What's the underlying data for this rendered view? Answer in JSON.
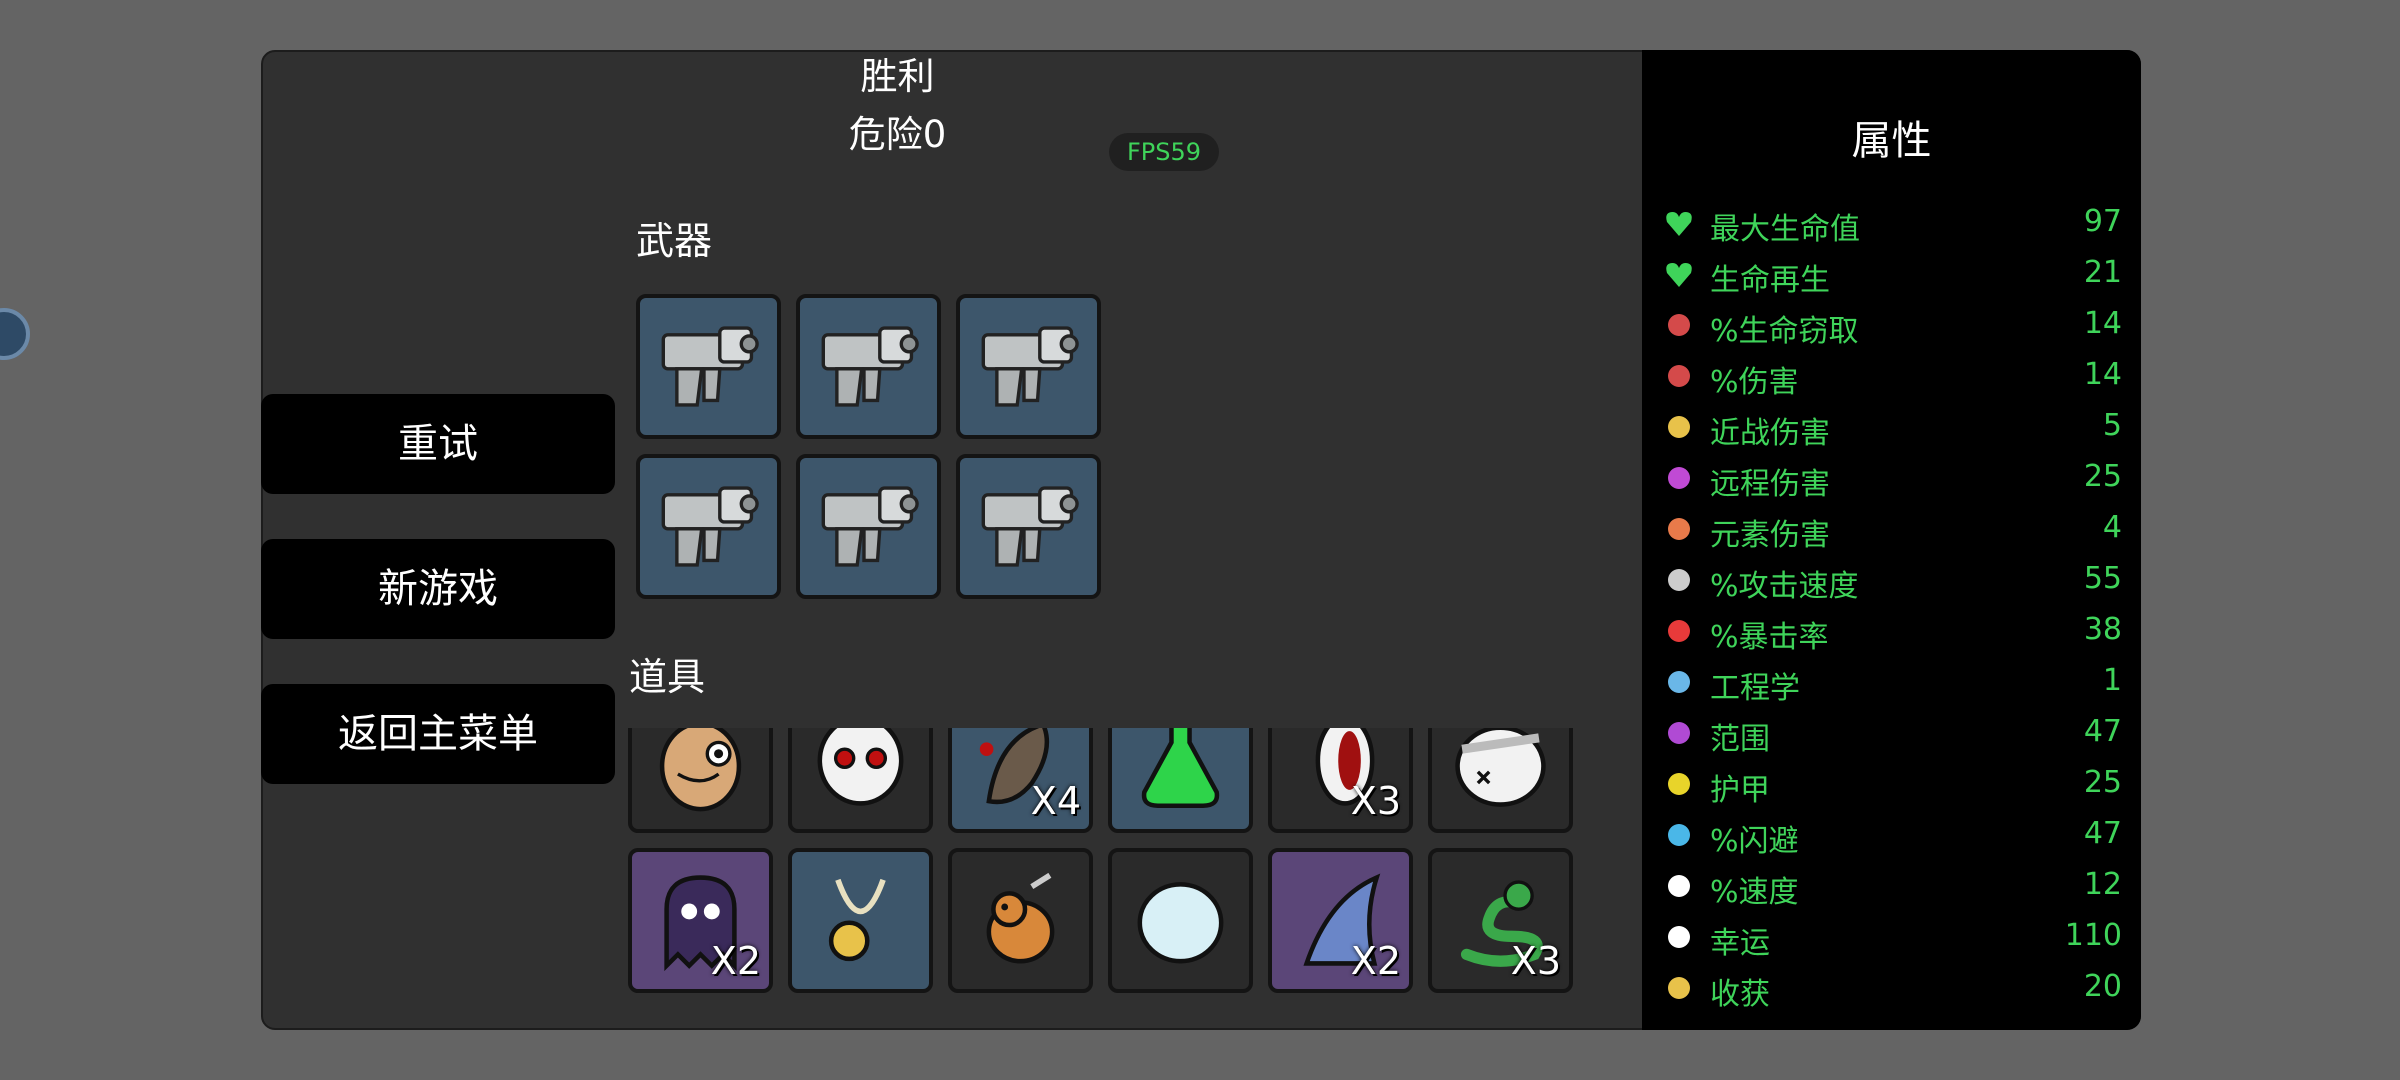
{
  "header": {
    "result": "胜利",
    "danger": "危险0",
    "fps": "FPS59"
  },
  "menu": {
    "retry": "重试",
    "new_game": "新游戏",
    "main_menu": "返回主菜单"
  },
  "sections": {
    "weapons": "武器",
    "items": "道具"
  },
  "weapons": [
    {
      "icon": "gun-icon"
    },
    {
      "icon": "gun-icon"
    },
    {
      "icon": "gun-icon"
    },
    {
      "icon": "gun-icon"
    },
    {
      "icon": "gun-icon"
    },
    {
      "icon": "gun-icon"
    }
  ],
  "items": [
    {
      "icon": "potato-face-icon",
      "count": "",
      "bg": "#2a2a2a"
    },
    {
      "icon": "skull-mask-icon",
      "count": "",
      "bg": "#2a2a2a"
    },
    {
      "icon": "leech-icon",
      "count": "X4",
      "bg": "#3d566b"
    },
    {
      "icon": "potion-icon",
      "count": "",
      "bg": "#3d566b"
    },
    {
      "icon": "mouth-icon",
      "count": "X3",
      "bg": "#2a2a2a"
    },
    {
      "icon": "bandaged-head-icon",
      "count": "",
      "bg": "#2a2a2a"
    },
    {
      "icon": "ghost-icon",
      "count": "X2",
      "bg": "#5b4678"
    },
    {
      "icon": "medal-icon",
      "count": "",
      "bg": "#3d566b"
    },
    {
      "icon": "bear-icon",
      "count": "",
      "bg": "#2a2a2a"
    },
    {
      "icon": "snowball-icon",
      "count": "",
      "bg": "#2a2a2a"
    },
    {
      "icon": "fin-icon",
      "count": "X2",
      "bg": "#5b4678"
    },
    {
      "icon": "snake-icon",
      "count": "X3",
      "bg": "#2a2a2a"
    }
  ],
  "stats": {
    "title": "属性",
    "rows": [
      {
        "icon": "heart-icon",
        "label": "最大生命值",
        "value": "97",
        "color": "#3fd45a"
      },
      {
        "icon": "heart-plus-icon",
        "label": "生命再生",
        "value": "21",
        "color": "#3fd45a"
      },
      {
        "icon": "fang-icon",
        "label": "%生命窃取",
        "value": "14",
        "color": "#d44a4a"
      },
      {
        "icon": "muscle-icon",
        "label": "%伤害",
        "value": "14",
        "color": "#d44a4a"
      },
      {
        "icon": "sword-icon",
        "label": "近战伤害",
        "value": "5",
        "color": "#e8c24a"
      },
      {
        "icon": "bow-icon",
        "label": "远程伤害",
        "value": "25",
        "color": "#c04ad4"
      },
      {
        "icon": "flame-icon",
        "label": "元素伤害",
        "value": "4",
        "color": "#e87a4a"
      },
      {
        "icon": "hourglass-icon",
        "label": "%攻击速度",
        "value": "55",
        "color": "#cccccc"
      },
      {
        "icon": "crit-icon",
        "label": "%暴击率",
        "value": "38",
        "color": "#e83a3a"
      },
      {
        "icon": "wrench-icon",
        "label": "工程学",
        "value": "1",
        "color": "#6ab7e8"
      },
      {
        "icon": "range-icon",
        "label": "范围",
        "value": "47",
        "color": "#b04ad4"
      },
      {
        "icon": "shield-icon",
        "label": "护甲",
        "value": "25",
        "color": "#e8d42a"
      },
      {
        "icon": "dodge-icon",
        "label": "%闪避",
        "value": "47",
        "color": "#4ab7e8"
      },
      {
        "icon": "boot-icon",
        "label": "%速度",
        "value": "12",
        "color": "#ffffff"
      },
      {
        "icon": "dice-icon",
        "label": "幸运",
        "value": "110",
        "color": "#ffffff"
      },
      {
        "icon": "wheat-icon",
        "label": "收获",
        "value": "20",
        "color": "#e8c24a"
      }
    ]
  }
}
